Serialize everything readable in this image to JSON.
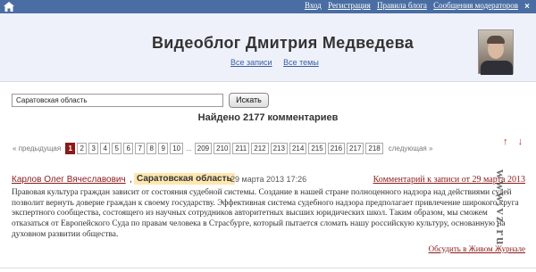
{
  "topbar": {
    "links": [
      "Вход",
      "Регистрация",
      "Правила блога",
      "Сообщения модераторов"
    ]
  },
  "header": {
    "title": "Видеоблог Дмитрия Медведева",
    "links": [
      "Все записи",
      "Все темы"
    ]
  },
  "search": {
    "value": "Саратовская область",
    "button_label": "Искать",
    "found_text": "Найдено 2177 комментариев"
  },
  "pager": {
    "prev_label": "« предыдущая",
    "next_label": "следующая »",
    "pages_start": [
      "1",
      "2",
      "3",
      "4",
      "5",
      "6",
      "7",
      "8",
      "9",
      "10"
    ],
    "ellipsis": "...",
    "pages_end": [
      "209",
      "210",
      "211",
      "212",
      "213",
      "214",
      "215",
      "216",
      "217",
      "218"
    ],
    "current_page": "1",
    "arrow_up": "↑",
    "arrow_down": "↓"
  },
  "comment": {
    "author": "Карлов Олег Вячеславович",
    "separator": ",",
    "region": "Саратовская область",
    "date": "29 марта 2013 17:26",
    "ref_link": "Комментарий к записи от 29 марта 2013",
    "text": "Правовая культура граждан зависит от состояния судебной системы. Создание в нашей стране полноценного надзора над действиями судей позволит вернуть доверие граждан к своему государству. Эффективная система судебного надзора предполагает привлечение широкого круга экспертного сообщества, состоящего из научных сотрудников авторитетных высших юридических школ. Таким образом, мы сможем отказаться от Европейского Суда по правам человека в Страсбурге, который пытается сломать нашу российскую культуру, основанную на духовном развитии общества.",
    "discuss_link": "Обсудить в Живом Журнале"
  },
  "watermark": "www.vz.ru",
  "colors": {
    "topbar": "#4a6ea3",
    "header_bg": "#eef1fa",
    "link_red": "#8b1a1a",
    "region_bg": "#ffe7b0",
    "active_page": "#8b1a1a"
  }
}
